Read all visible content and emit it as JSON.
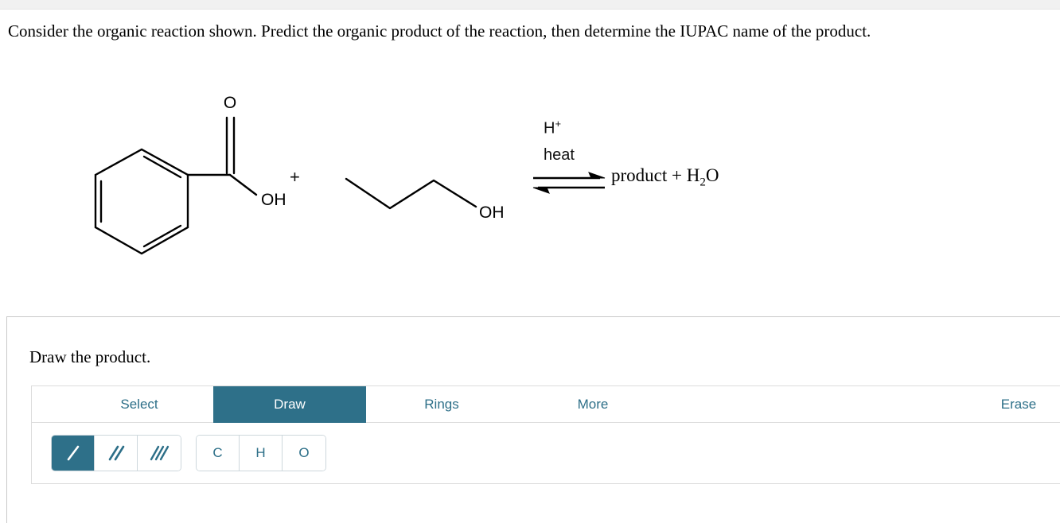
{
  "prompt": {
    "text": "Consider the organic reaction shown. Predict the organic product of the reaction, then determine the IUPAC name of the product."
  },
  "reaction": {
    "reactant1_name": "benzoic acid",
    "reactant1_labels": {
      "carbonyl_oxygen": "O",
      "hydroxyl": "OH"
    },
    "plus": "+",
    "reactant2_name": "propan-1-ol",
    "reactant2_labels": {
      "hydroxyl": "OH"
    },
    "conditions_line1": "H",
    "conditions_line1_sup": "+",
    "conditions_line2": "heat",
    "arrow_type": "equilibrium",
    "products_pre": "product + H",
    "products_sub": "2",
    "products_post": "O"
  },
  "answer_panel": {
    "title": "Draw the product."
  },
  "editor": {
    "tabs": [
      {
        "label": "Select",
        "active": false
      },
      {
        "label": "Draw",
        "active": true
      },
      {
        "label": "Rings",
        "active": false
      },
      {
        "label": "More",
        "active": false
      },
      {
        "label": "Erase",
        "active": false
      }
    ],
    "bond_tools": [
      {
        "name": "single-bond",
        "active": true
      },
      {
        "name": "double-bond",
        "active": false
      },
      {
        "name": "triple-bond",
        "active": false
      }
    ],
    "atom_tools": [
      {
        "label": "C",
        "active": false
      },
      {
        "label": "H",
        "active": false
      },
      {
        "label": "O",
        "active": false
      }
    ]
  },
  "colors": {
    "accent": "#2e7089",
    "link": "#2d6f88",
    "panel_border": "#c9c9c9",
    "top_strip": "#f1f1f1"
  }
}
